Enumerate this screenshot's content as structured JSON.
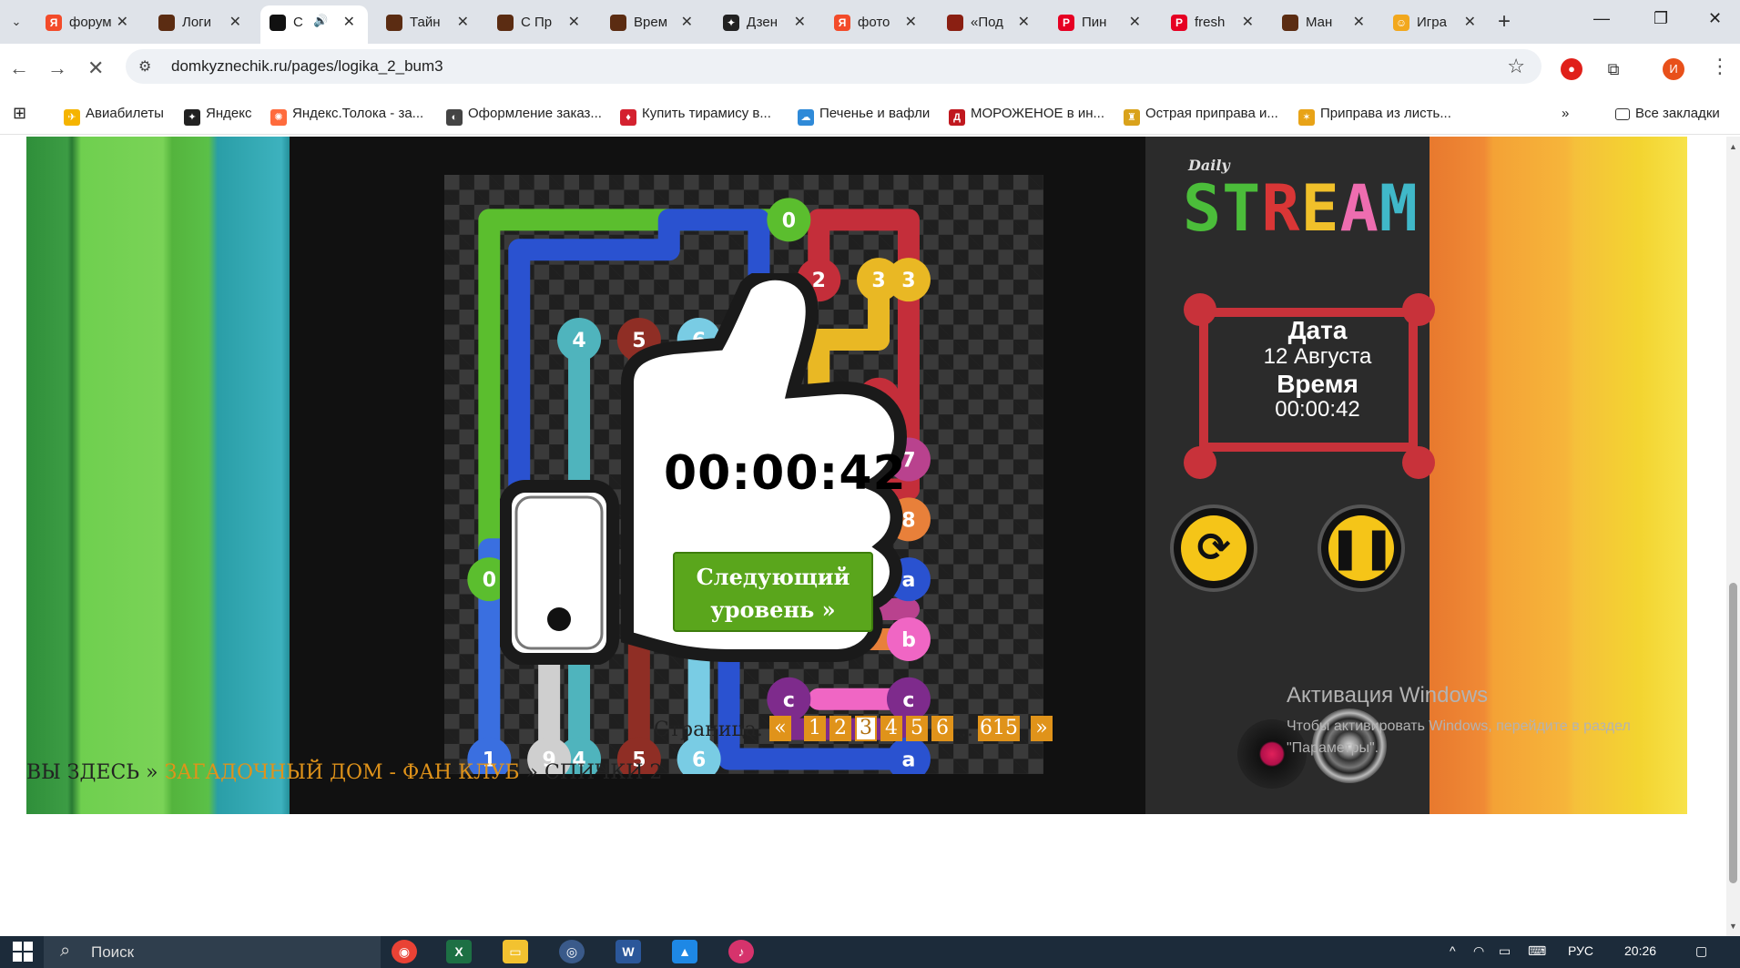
{
  "tabs": [
    {
      "title": "форум",
      "fav_color": "#f34b2a",
      "fav_glyph": "Я"
    },
    {
      "title": "Логи",
      "fav_color": "#5b2c12",
      "fav_glyph": ""
    },
    {
      "title": "С",
      "fav_color": "#111111",
      "fav_glyph": "",
      "active": true
    },
    {
      "title": "Тайн",
      "fav_color": "#5b2c12",
      "fav_glyph": ""
    },
    {
      "title": "С Пр",
      "fav_color": "#5b2c12",
      "fav_glyph": ""
    },
    {
      "title": "Врем",
      "fav_color": "#5b2c12",
      "fav_glyph": ""
    },
    {
      "title": "Дзен",
      "fav_color": "#222222",
      "fav_glyph": "✦"
    },
    {
      "title": "фото",
      "fav_color": "#f34b2a",
      "fav_glyph": "Я"
    },
    {
      "title": "«Под",
      "fav_color": "#8a1f12",
      "fav_glyph": ""
    },
    {
      "title": "Пин",
      "fav_color": "#e60023",
      "fav_glyph": "P"
    },
    {
      "title": "fresh",
      "fav_color": "#e60023",
      "fav_glyph": "P"
    },
    {
      "title": "Ман",
      "fav_color": "#5b2c12",
      "fav_glyph": ""
    },
    {
      "title": "Игра",
      "fav_color": "#f2a81d",
      "fav_glyph": "☺"
    }
  ],
  "address": {
    "url": "domkyznechik.ru/pages/logika_2_bum3"
  },
  "profile_initial": "И",
  "bookmarks": [
    {
      "label": "Авиабилеты",
      "color": "#f5b400",
      "glyph": "✈"
    },
    {
      "label": "Яндекс",
      "color": "#222222",
      "glyph": "✦"
    },
    {
      "label": "Яндекс.Толока - за...",
      "color": "#ff6b3d",
      "glyph": "✺"
    },
    {
      "label": "Оформление заказ...",
      "color": "#444444",
      "glyph": "◐"
    },
    {
      "label": "Купить тирамису в...",
      "color": "#d4212f",
      "glyph": "♦"
    },
    {
      "label": "Печенье и вафли",
      "color": "#2f8ad8",
      "glyph": "☁"
    },
    {
      "label": "МОРОЖЕНОЕ в ин...",
      "color": "#c0181f",
      "glyph": "Д"
    },
    {
      "label": "Острая приправа и...",
      "color": "#d9a21b",
      "glyph": "♜"
    },
    {
      "label": "Приправа из листь...",
      "color": "#e8a317",
      "glyph": "✶"
    }
  ],
  "all_bookmarks_label": "Все закладки",
  "puzzle": {
    "endpoints": [
      {
        "label": "0",
        "color": "#5bbe2e"
      },
      {
        "label": "0",
        "color": "#5bbe2e"
      },
      {
        "label": "1",
        "color": "#3a6fe0"
      },
      {
        "label": "2",
        "color": "#c42e3a"
      },
      {
        "label": "2",
        "color": "#c42e3a"
      },
      {
        "label": "3",
        "color": "#e9b824"
      },
      {
        "label": "3",
        "color": "#e9b824"
      },
      {
        "label": "4",
        "color": "#4fb4bd"
      },
      {
        "label": "4",
        "color": "#4fb4bd"
      },
      {
        "label": "5",
        "color": "#8f2e25"
      },
      {
        "label": "5",
        "color": "#8f2e25"
      },
      {
        "label": "6",
        "color": "#79cce4"
      },
      {
        "label": "6",
        "color": "#79cce4"
      },
      {
        "label": "7",
        "color": "#b9428e"
      },
      {
        "label": "8",
        "color": "#e8803a"
      },
      {
        "label": "9",
        "color": "#cfcfcf"
      },
      {
        "label": "a",
        "color": "#2a52d0"
      },
      {
        "label": "a",
        "color": "#2a52d0"
      },
      {
        "label": "b",
        "color": "#f066c4"
      },
      {
        "label": "c",
        "color": "#7e2b8c"
      },
      {
        "label": "c",
        "color": "#7e2b8c"
      }
    ]
  },
  "overlay": {
    "time": "00:00:42",
    "next_level": "Следующий уровень »"
  },
  "panel": {
    "logo_small": "Daily",
    "logo_big": "STREAM",
    "logo_letters": [
      {
        "ch": "S",
        "color": "#4bbd3a"
      },
      {
        "ch": "T",
        "color": "#4bbd3a"
      },
      {
        "ch": "R",
        "color": "#d93636"
      },
      {
        "ch": "E",
        "color": "#f0c02a"
      },
      {
        "ch": "A",
        "color": "#ee6db0"
      },
      {
        "ch": "M",
        "color": "#40b8c9"
      }
    ],
    "date_label": "Дата",
    "date_value": "12 Августа",
    "time_label": "Время",
    "time_value": "00:00:42",
    "restart_icon": "refresh-icon",
    "pause_icon": "pause-icon"
  },
  "pagination": {
    "label": "Страница:",
    "prev": "«",
    "pages": [
      "1",
      "2",
      "3",
      "4",
      "5",
      "6"
    ],
    "current": "3",
    "ellipsis": "...",
    "last": "615",
    "next": "»"
  },
  "windows_watermark": {
    "title": "Активация Windows",
    "text": "Чтобы активировать Windows, перейдите в раздел \"Параметры\"."
  },
  "breadcrumb": {
    "prefix": "ВЫ ЗДЕСЬ »",
    "link": "ЗАГАДОЧНЫЙ ДОМ - ФАН КЛУБ",
    "sep": "»",
    "current": "СПИЧКИ 2"
  },
  "taskbar": {
    "search_placeholder": "Поиск",
    "lang": "РУС",
    "clock": "20:26"
  }
}
